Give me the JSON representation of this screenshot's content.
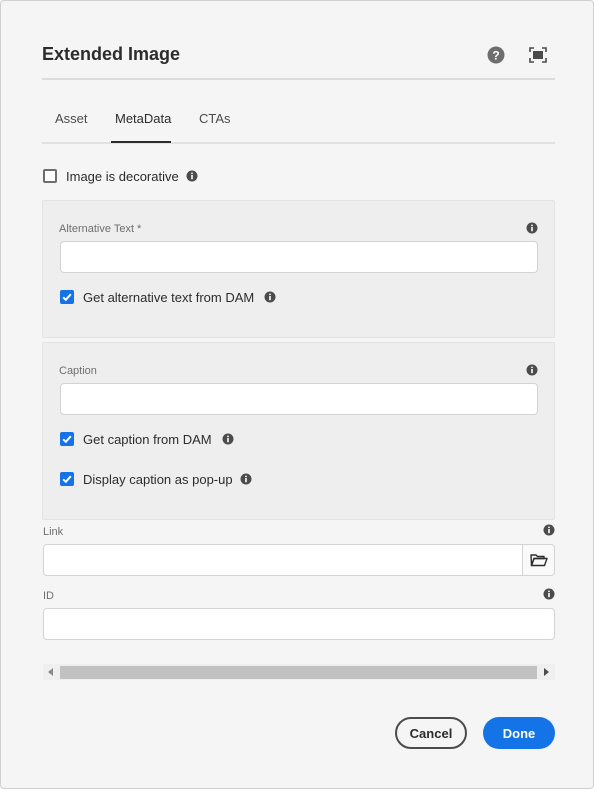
{
  "dialog": {
    "title": "Extended Image",
    "help_icon": "help-icon",
    "fullscreen_icon": "fullscreen-icon"
  },
  "tabs": [
    {
      "label": "Asset",
      "active": false
    },
    {
      "label": "MetaData",
      "active": true
    },
    {
      "label": "CTAs",
      "active": false
    }
  ],
  "decorative": {
    "label": "Image is decorative",
    "checked": false
  },
  "alt_text": {
    "label": "Alternative Text *",
    "value": "",
    "from_dam": {
      "label": "Get alternative text from DAM",
      "checked": true
    }
  },
  "caption": {
    "label": "Caption",
    "value": "",
    "from_dam": {
      "label": "Get caption from DAM",
      "checked": true
    },
    "popup": {
      "label": "Display caption as pop-up",
      "checked": true
    }
  },
  "link": {
    "label": "Link",
    "value": "",
    "browse_icon": "folder-icon"
  },
  "id_field": {
    "label": "ID",
    "value": ""
  },
  "footer": {
    "cancel_label": "Cancel",
    "done_label": "Done"
  },
  "colors": {
    "accent": "#1473e6",
    "dialog_bg": "#f5f5f5",
    "panel_bg": "#eeeeee"
  }
}
